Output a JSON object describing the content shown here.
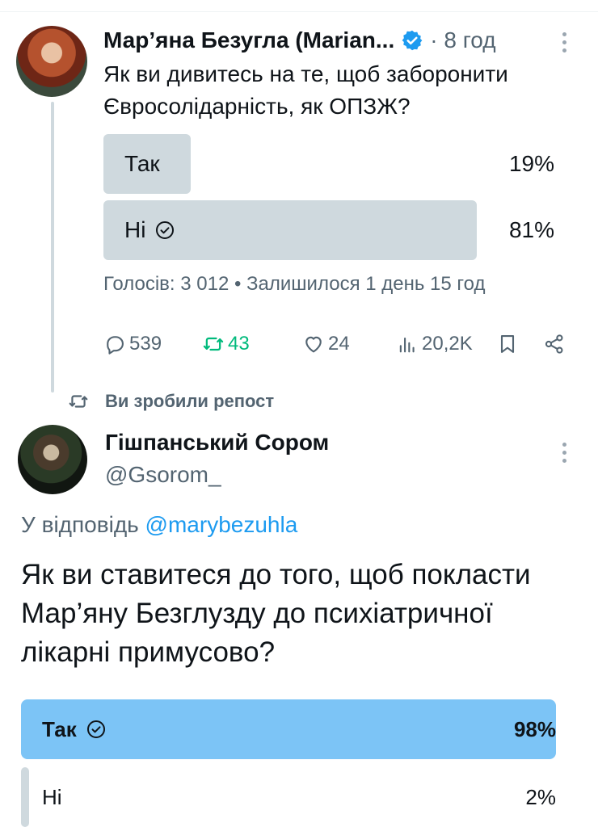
{
  "tweet1": {
    "author_name": "Мар’яна Безугла (Marian...",
    "time": "· 8 год",
    "text": "Як ви дивитесь на те, щоб заборонити Євросолідарність, як ОПЗЖ?",
    "poll": {
      "options": [
        {
          "label": "Так",
          "percent_text": "19%",
          "percent": 19,
          "selected": false
        },
        {
          "label": "Ні",
          "percent_text": "81%",
          "percent": 81,
          "selected": true
        }
      ],
      "meta": "Голосів: 3 012 • Залишилося 1 день 15 год"
    },
    "actions": {
      "replies": "539",
      "reposts": "43",
      "likes": "24",
      "views": "20,2K"
    },
    "colors": {
      "poll_bar": "#cfd9de",
      "repost_active": "#00ba7c"
    }
  },
  "repost_note": "Ви зробили репост",
  "tweet2": {
    "author_name": "Гішпанський Сором",
    "handle": "@Gsorom_",
    "reply_prefix": "У відповідь",
    "reply_handle": "@marybezuhla",
    "text": "Як ви ставитеся до того, щоб покласти Мар’яну Безглузду до психіатричної лікарні примусово?",
    "poll": {
      "options": [
        {
          "label": "Так",
          "percent_text": "98%",
          "percent": 98,
          "selected": true
        },
        {
          "label": "Ні",
          "percent_text": "2%",
          "percent": 2,
          "selected": false
        }
      ]
    },
    "colors": {
      "poll_winner": "#7cc4f6",
      "poll_other": "#cfd9de",
      "link": "#1d9bf0"
    }
  },
  "icons": [
    "verified-badge-icon",
    "more-icon",
    "reply-icon",
    "repost-icon",
    "like-icon",
    "views-icon",
    "bookmark-icon",
    "share-icon",
    "check-circle-icon"
  ]
}
